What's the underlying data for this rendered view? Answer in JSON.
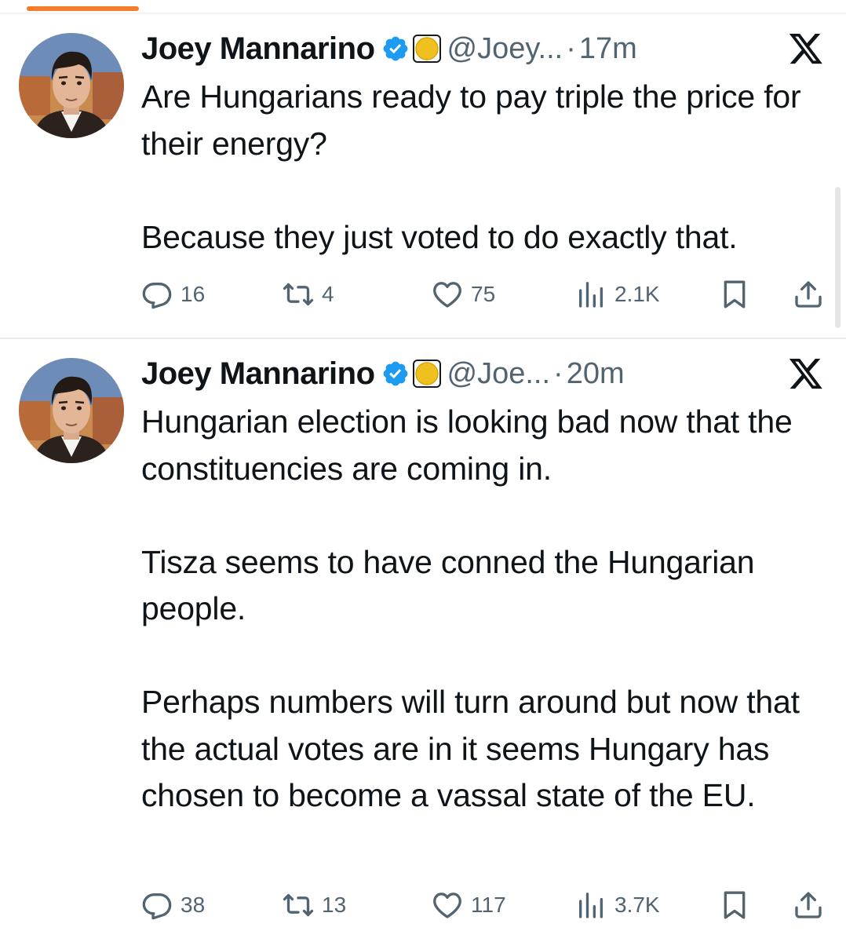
{
  "colors": {
    "accent": "#f57c2a",
    "verified": "#1d9bf0",
    "gold": "#f0c021",
    "muted": "#536471",
    "text": "#0f1419"
  },
  "tweets": [
    {
      "author": "Joey Mannarino",
      "handle": "@Joey...",
      "separator": "·",
      "time": "17m",
      "paragraphs": [
        "Are Hungarians ready to pay triple the price for their energy?",
        "Because they just voted to do exactly that."
      ],
      "replies": "16",
      "reposts": "4",
      "likes": "75",
      "views": "2.1K"
    },
    {
      "author": "Joey Mannarino",
      "handle": "@Joe...",
      "separator": "·",
      "time": "20m",
      "paragraphs": [
        "Hungarian election is looking bad now that the constituencies are coming in.",
        "Tisza seems to have conned the Hungarian people.",
        "Perhaps numbers will turn around but now that the actual votes are in it seems Hungary has chosen to become a vassal state of the EU."
      ],
      "replies": "38",
      "reposts": "13",
      "likes": "117",
      "views": "3.7K"
    }
  ],
  "icons": [
    "verified-badge-icon",
    "gold-circle-icon",
    "x-logo-icon",
    "reply-icon",
    "repost-icon",
    "like-icon",
    "views-icon",
    "bookmark-icon",
    "share-icon"
  ]
}
